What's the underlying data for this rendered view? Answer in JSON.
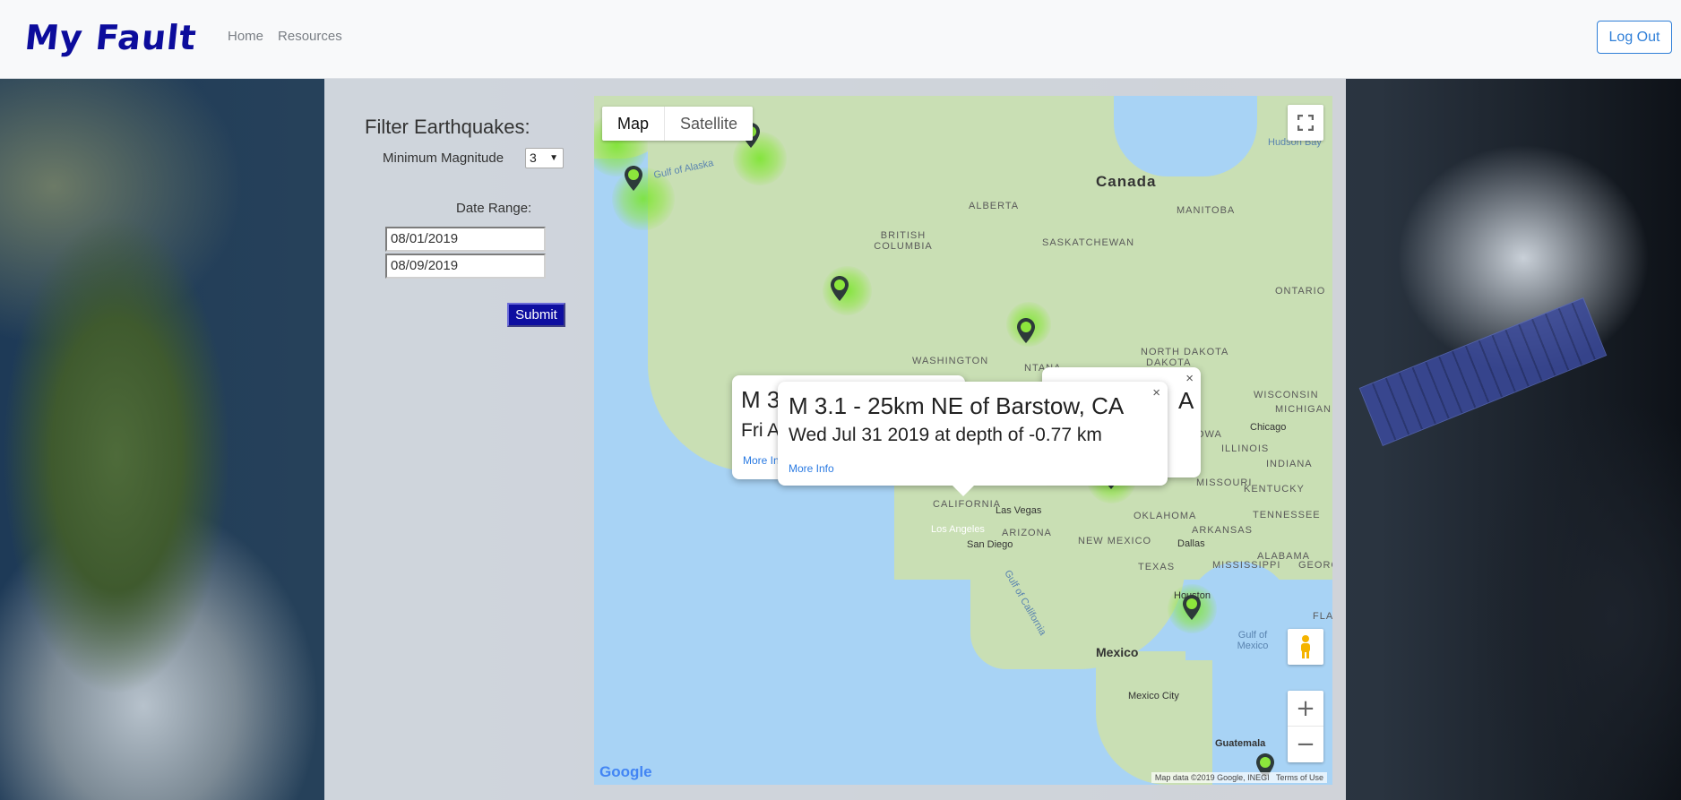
{
  "brand": "My Fault",
  "nav": {
    "home": "Home",
    "resources": "Resources",
    "logout": "Log Out"
  },
  "filter": {
    "title": "Filter Earthquakes:",
    "min_magnitude_label": "Minimum Magnitude",
    "min_magnitude_value": "3",
    "date_range_label": "Date Range:",
    "start_date": "08/01/2019",
    "end_date": "08/09/2019",
    "submit_label": "Submit"
  },
  "map": {
    "type_map": "Map",
    "type_satellite": "Satellite",
    "zoom_in": "+",
    "zoom_out": "−",
    "attribution": "Map data ©2019 Google, INEGI",
    "terms": "Terms of Use",
    "google_logo": "Google",
    "labels": {
      "canada": "Canada",
      "mexico": "Mexico",
      "gulf_of_alaska": "Gulf of Alaska",
      "alberta": "ALBERTA",
      "british_columbia": "BRITISH COLUMBIA",
      "saskatchewan": "SASKATCHEWAN",
      "manitoba": "MANITOBA",
      "ontario": "ONTARIO",
      "hudson_bay": "Hudson Bay",
      "washington": "WASHINGTON",
      "north_dakota": "NORTH DAKOTA",
      "dakota": "DAKOTA",
      "wisconsin": "WISCONSIN",
      "michigan": "MICHIGAN",
      "chicago": "Chicago",
      "illinois": "ILLINOIS",
      "indiana": "INDIANA",
      "missouri": "MISSOURI",
      "kentucky": "KENTUCKY",
      "tennessee": "TENNESSEE",
      "arkansas": "ARKANSAS",
      "oklahoma": "OKLAHOMA",
      "texas": "TEXAS",
      "dallas": "Dallas",
      "houston": "Houston",
      "alabama": "ALABAMA",
      "georgia": "GEORG",
      "mississippi": "MISSISSIPPI",
      "new_mexico": "NEW MEXICO",
      "arizona": "ARIZONA",
      "las_vegas": "Las Vegas",
      "los_angeles": "Los Angeles",
      "california": "CALIFORNIA",
      "san_diego": "San Diego",
      "gulf_of_california": "Gulf of California",
      "gulf_of_mexico": "Gulf of Mexico",
      "mexico_city": "Mexico City",
      "guatemala": "Guatemala",
      "fla": "FLA",
      "montana": "NTANA",
      "iowa": "OWA"
    },
    "popups": {
      "back1_title": "M 3",
      "back1_sub": "Fri A",
      "back1_link": "More In",
      "back2_tail": "A",
      "front_title": "M 3.1 - 25km NE of Barstow, CA",
      "front_sub": "Wed Jul 31 2019 at depth of -0.77 km",
      "front_link": "More Info",
      "close": "×"
    }
  },
  "colors": {
    "brand": "#0c0c9c",
    "submit_bg": "#0e0ea0",
    "logout_border": "#2f7fd8",
    "heat_low": "#8ce63c",
    "heat_high": "#f0781e"
  }
}
